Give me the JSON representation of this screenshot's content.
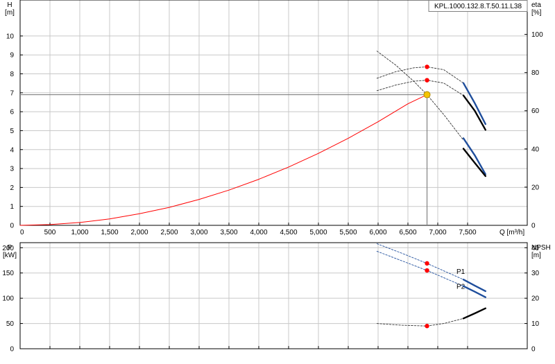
{
  "chart_data": [
    {
      "type": "line",
      "title": "KPL.1000.132.8.T.50.11.L38",
      "xlabel": "Q [m³/h]",
      "xlim": [
        0,
        8500
      ],
      "x_ticks": [
        "0",
        "500",
        "1,000",
        "1,500",
        "2,000",
        "2,500",
        "3,000",
        "3,500",
        "4,000",
        "4,500",
        "5,000",
        "5,500",
        "6,000",
        "6,500",
        "7,000",
        "7,500"
      ],
      "x_tick_values": [
        0,
        500,
        1000,
        1500,
        2000,
        2500,
        3000,
        3500,
        4000,
        4500,
        5000,
        5500,
        6000,
        6500,
        7000,
        7500
      ],
      "y_left": {
        "label_top": "H",
        "label_unit": "[m]",
        "lim": [
          0,
          11.9
        ],
        "ticks": [
          "0",
          "1",
          "2",
          "3",
          "4",
          "5",
          "6",
          "7",
          "8",
          "9",
          "10"
        ],
        "tick_values": [
          0,
          1,
          2,
          3,
          4,
          5,
          6,
          7,
          8,
          9,
          10
        ]
      },
      "y_right": {
        "label_top": "eta",
        "label_unit": "[%]",
        "lim": [
          0,
          118
        ],
        "ticks": [
          "0",
          "20",
          "40",
          "60",
          "80",
          "100"
        ],
        "tick_values": [
          0,
          20,
          40,
          60,
          80,
          100
        ]
      },
      "grid": true,
      "series": [
        {
          "role": "system-curve",
          "axis": "left",
          "color": "#ff0000",
          "style": "solid",
          "x": [
            0,
            500,
            1000,
            1500,
            2000,
            2500,
            3000,
            3500,
            4000,
            4500,
            5000,
            5500,
            6000,
            6500,
            6820
          ],
          "y": [
            0,
            0.04,
            0.15,
            0.34,
            0.61,
            0.95,
            1.37,
            1.86,
            2.43,
            3.08,
            3.8,
            4.6,
            5.47,
            6.42,
            6.9
          ]
        },
        {
          "role": "pump-head-dashed",
          "axis": "left",
          "color": "#333333",
          "style": "dashed",
          "x": [
            5980,
            6300,
            6600,
            6820,
            7100,
            7430
          ],
          "y": [
            9.2,
            8.45,
            7.6,
            6.9,
            5.85,
            4.5
          ]
        },
        {
          "role": "pump-head-blue",
          "axis": "left",
          "color": "#1f4e9c",
          "style": "thick",
          "x": [
            7430,
            7620,
            7800
          ],
          "y": [
            4.6,
            3.7,
            2.7
          ]
        },
        {
          "role": "pump-head-black",
          "axis": "left",
          "color": "#000000",
          "style": "thick",
          "x": [
            7430,
            7620,
            7800
          ],
          "y": [
            4.05,
            3.3,
            2.6
          ]
        },
        {
          "role": "eta-upper-dashed",
          "axis": "right",
          "color": "#333333",
          "style": "dashed",
          "x": [
            5980,
            6300,
            6600,
            6820,
            7100,
            7430
          ],
          "y": [
            77,
            80.5,
            82.5,
            83,
            81.5,
            74.5
          ]
        },
        {
          "role": "eta-lower-dashed",
          "axis": "right",
          "color": "#333333",
          "style": "dashed",
          "x": [
            5980,
            6300,
            6600,
            6820,
            7100,
            7430
          ],
          "y": [
            70.5,
            73.5,
            75.5,
            76,
            74.5,
            68
          ]
        },
        {
          "role": "eta-blue",
          "axis": "right",
          "color": "#1f4e9c",
          "style": "thick",
          "x": [
            7430,
            7620,
            7800
          ],
          "y": [
            74.5,
            64,
            53
          ]
        },
        {
          "role": "eta-black",
          "axis": "right",
          "color": "#000000",
          "style": "thick",
          "x": [
            7430,
            7620,
            7800
          ],
          "y": [
            68,
            60,
            50
          ]
        }
      ],
      "operating_point": {
        "x": 6820,
        "y": 6.9,
        "color": "#f5c400"
      },
      "markers": [
        {
          "axis": "right",
          "x": 6820,
          "y": 83,
          "color": "#ff0000"
        },
        {
          "axis": "right",
          "x": 6820,
          "y": 76,
          "color": "#ff0000"
        }
      ]
    },
    {
      "type": "line",
      "xlim": [
        0,
        8500
      ],
      "x_tick_values": [
        0,
        500,
        1000,
        1500,
        2000,
        2500,
        3000,
        3500,
        4000,
        4500,
        5000,
        5500,
        6000,
        6500,
        7000,
        7500
      ],
      "y_left": {
        "label_top": "P",
        "label_unit": "[kW]",
        "lim": [
          0,
          210
        ],
        "ticks": [
          "0",
          "50",
          "100",
          "150",
          "200"
        ],
        "tick_values": [
          0,
          50,
          100,
          150,
          200
        ]
      },
      "y_right": {
        "label_top": "NPSH",
        "label_unit": "[m]",
        "lim": [
          0,
          42
        ],
        "ticks": [
          "0",
          "10",
          "20",
          "30",
          "40"
        ],
        "tick_values": [
          0,
          10,
          20,
          30,
          40
        ]
      },
      "grid": true,
      "series": [
        {
          "name": "P1",
          "role": "p1-dashed",
          "axis": "left",
          "color": "#1f4e9c",
          "style": "dashed",
          "x": [
            5980,
            6400,
            6820,
            7430
          ],
          "y": [
            208,
            189,
            169,
            137
          ]
        },
        {
          "role": "p1-solid",
          "axis": "left",
          "color": "#1f4e9c",
          "style": "thick",
          "x": [
            7430,
            7620,
            7800
          ],
          "y": [
            137,
            125,
            114
          ]
        },
        {
          "name": "P2",
          "role": "p2-dashed",
          "axis": "left",
          "color": "#1f4e9c",
          "style": "dashed",
          "x": [
            5980,
            6400,
            6820,
            7430
          ],
          "y": [
            193,
            174,
            155,
            124
          ]
        },
        {
          "role": "p2-solid",
          "axis": "left",
          "color": "#1f4e9c",
          "style": "thick",
          "x": [
            7430,
            7620,
            7800
          ],
          "y": [
            124,
            113,
            102
          ]
        },
        {
          "role": "npsh-dashed",
          "axis": "right",
          "color": "#333333",
          "style": "dashed",
          "x": [
            5980,
            6400,
            6820,
            7100,
            7430
          ],
          "y": [
            10,
            9.3,
            9,
            10,
            12
          ]
        },
        {
          "role": "npsh-solid",
          "axis": "right",
          "color": "#000000",
          "style": "thick",
          "x": [
            7430,
            7620,
            7800
          ],
          "y": [
            12,
            14,
            16
          ]
        }
      ],
      "markers": [
        {
          "axis": "left",
          "x": 6820,
          "y": 169,
          "color": "#ff0000"
        },
        {
          "axis": "left",
          "x": 6820,
          "y": 155,
          "color": "#ff0000"
        },
        {
          "axis": "right",
          "x": 6820,
          "y": 9,
          "color": "#ff0000"
        }
      ]
    }
  ]
}
